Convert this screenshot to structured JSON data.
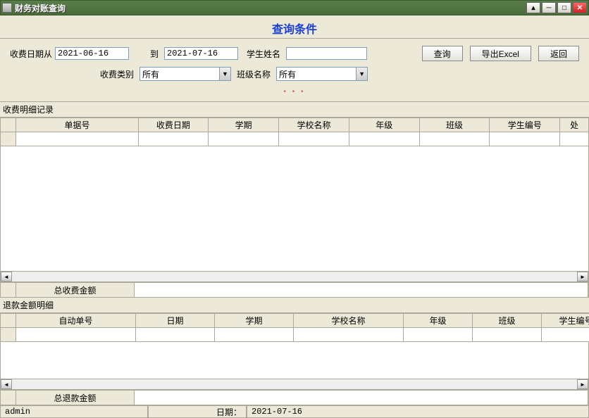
{
  "titlebar": {
    "title": "财务对账查询"
  },
  "section": {
    "title": "查询条件"
  },
  "form": {
    "date_from_label": "收费日期从",
    "date_from": "2021-06-16",
    "to_label": "到",
    "date_to": "2021-07-16",
    "student_name_label": "学生姓名",
    "student_name": "",
    "fee_type_label": "收费类别",
    "fee_type": "所有",
    "class_name_label": "班级名称",
    "class_name": "所有",
    "btn_query": "查询",
    "btn_export": "导出Excel",
    "btn_back": "返回"
  },
  "panel1": {
    "group_label": "收费明细记录",
    "columns": [
      "单据号",
      "收费日期",
      "学期",
      "学校名称",
      "年级",
      "班级",
      "学生编号",
      "处"
    ],
    "summary_label": "总收费金额"
  },
  "panel2": {
    "group_label": "退款金额明细",
    "columns": [
      "自动单号",
      "日期",
      "学期",
      "学校名称",
      "年级",
      "班级",
      "学生编号"
    ],
    "summary_label": "总退款金额"
  },
  "statusbar": {
    "user": "admin",
    "date_label": "日期：",
    "date": "2021-07-16"
  }
}
